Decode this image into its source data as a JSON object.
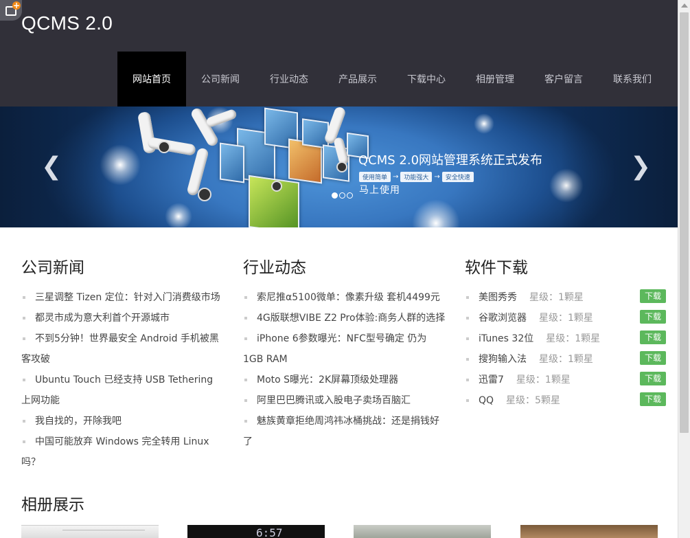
{
  "site": {
    "title": "QCMS 2.0"
  },
  "nav": [
    {
      "label": "网站首页",
      "active": true
    },
    {
      "label": "公司新闻"
    },
    {
      "label": "行业动态"
    },
    {
      "label": "产品展示"
    },
    {
      "label": "下载中心"
    },
    {
      "label": "相册管理"
    },
    {
      "label": "客户留言"
    },
    {
      "label": "联系我们"
    }
  ],
  "banner": {
    "title": "QCMS 2.0网站管理系统正式发布",
    "tags": [
      "使用简单",
      "功能强大",
      "安全快速"
    ],
    "subtitle": "马上使用",
    "slide_count": 3,
    "active_slide": 1
  },
  "news": {
    "title": "公司新闻",
    "items": [
      "三星调整 Tizen 定位：针对入门消费级市场",
      "都灵市成为意大利首个开源城市",
      "不到5分钟！世界最安全 Android 手机被黑客攻破",
      "Ubuntu Touch 已经支持 USB Tethering 上网功能",
      "我自找的，开除我吧",
      "中国可能放弃 Windows 完全转用 Linux 吗？"
    ]
  },
  "industry": {
    "title": "行业动态",
    "items": [
      "索尼推α5100微单：像素升级 套机4499元",
      "4G版联想VIBE Z2 Pro体验:商务人群的选择",
      "iPhone 6参数曝光：NFC型号确定 仍为1GB RAM",
      "Moto S曝光：2K屏幕顶级处理器",
      "阿里巴巴腾讯或入股电子卖场百脑汇",
      "魅族黄章拒绝周鸿祎冰桶挑战：还是捐钱好了"
    ]
  },
  "downloads": {
    "title": "软件下载",
    "button_label": "下载",
    "items": [
      {
        "name": "美图秀秀",
        "rating": "星级：1颗星"
      },
      {
        "name": "谷歌浏览器",
        "rating": "星级：1颗星"
      },
      {
        "name": "iTunes 32位",
        "rating": "星级：1颗星"
      },
      {
        "name": "搜狗输入法",
        "rating": "星级：1颗星"
      },
      {
        "name": "迅雷7",
        "rating": "星级：1颗星"
      },
      {
        "name": "QQ",
        "rating": "星级：5颗星"
      }
    ]
  },
  "album": {
    "title": "相册展示"
  },
  "icons": {
    "corner": "add-bookmark-icon",
    "prev": "chevron-left-icon",
    "next": "chevron-right-icon"
  },
  "colors": {
    "header_bg": "#313039",
    "nav_active_bg": "#000000",
    "download_button": "#5cb85c"
  }
}
